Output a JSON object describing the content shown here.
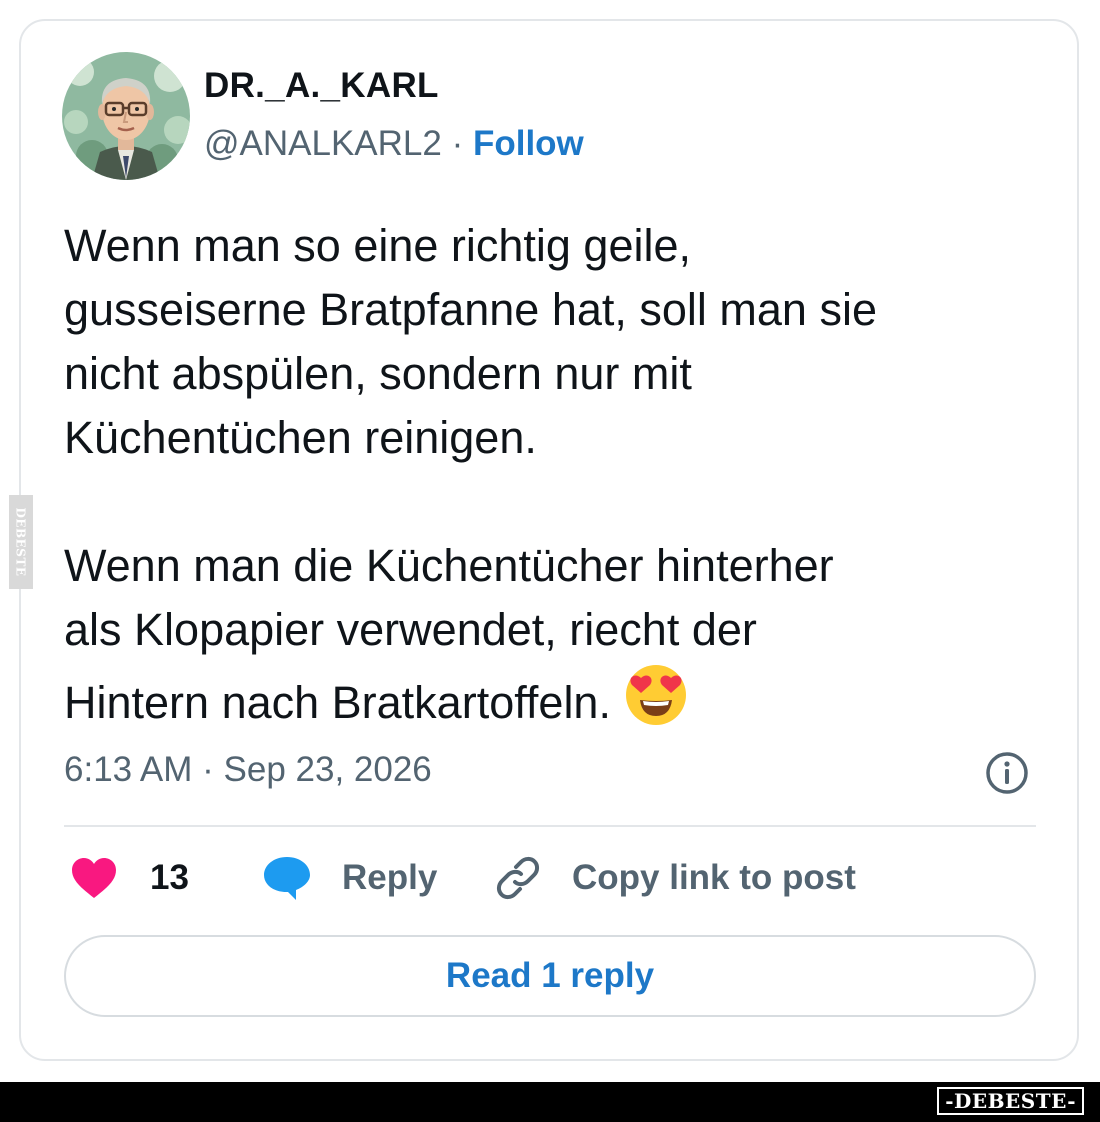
{
  "author": {
    "display_name": "DR._A._KARL",
    "handle": "@ANALKARL2",
    "separator": " · ",
    "follow_label": "Follow",
    "avatar_icon": "cartoon-man-with-glasses-avatar"
  },
  "tweet": {
    "paragraph_1": "Wenn man so eine richtig geile,\ngusseiserne Bratpfanne hat, soll man sie\nnicht abspülen, sondern nur mit\nKüchentüchen reinigen.",
    "paragraph_2": "Wenn man die Küchentücher hinterher\nals Klopapier verwendet, riecht der\nHintern nach Bratkartoffeln. ",
    "emoji": "smiling-face-with-heart-eyes-emoji",
    "timestamp": "6:13 AM · Sep 23, 2026"
  },
  "actions": {
    "like_count": "13",
    "reply_label": "Reply",
    "copy_link_label": "Copy link to post",
    "read_replies_label": "Read 1 reply"
  },
  "watermark": {
    "side_text": "DEBESTE",
    "bottom_text": "-DEBESTE-"
  },
  "colors": {
    "like": "#f91880",
    "link": "#1d78c8",
    "reply_bubble": "#1d9bf0",
    "secondary_text": "#536471"
  }
}
